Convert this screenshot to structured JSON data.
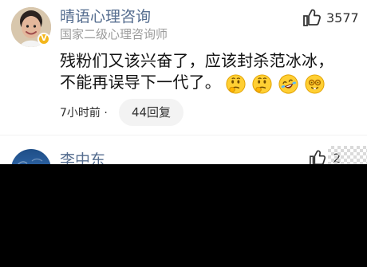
{
  "comment": {
    "username": "晴语心理咨询",
    "title": "国家二级心理咨询师",
    "like_count": "3577",
    "text_line1": "残粉们又该兴奋了，应该封杀范冰冰，",
    "text_line2": "不能再误导下一代了。",
    "time": "7小时前 ·",
    "reply_label": "44回复",
    "emoji_icons": [
      "thinking-face-icon",
      "thinking-face-icon",
      "rolling-laughing-face-icon",
      "nerd-face-icon"
    ]
  },
  "next_comment": {
    "username": "李中东",
    "like_count_partial": "2"
  },
  "colors": {
    "username": "#556d8f",
    "meta": "#9b9b9b",
    "body_text": "#111111",
    "reply_bg": "#f3f3f3",
    "verified_badge": "#f3b61b",
    "black_area": "#000000"
  },
  "icons": {
    "verified": "verified-badge-icon",
    "like": "thumbs-up-icon"
  }
}
